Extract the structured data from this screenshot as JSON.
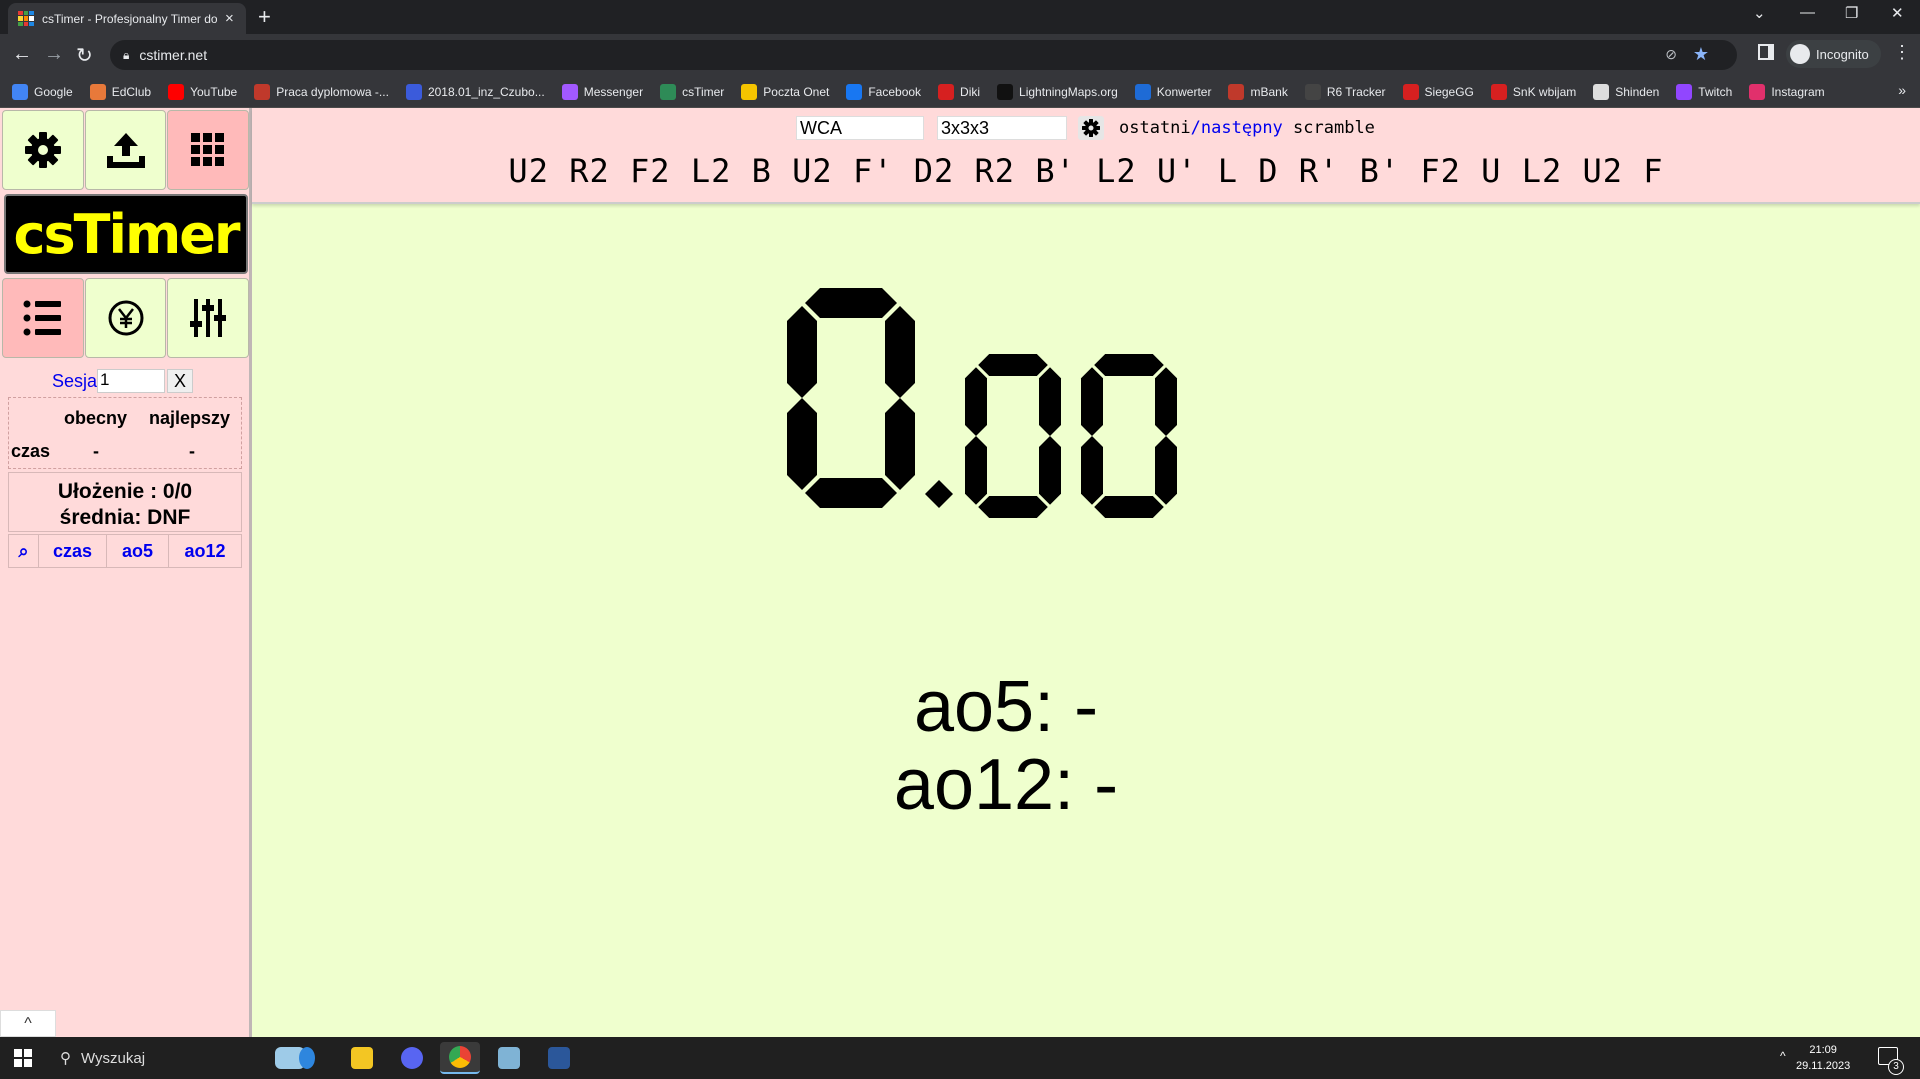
{
  "browser": {
    "tab_title": "csTimer - Profesjonalny Timer do kostki Rubika",
    "tab_close": "×",
    "new_tab": "+",
    "url": "cstimer.net",
    "profile_label": "Incognito",
    "bookmarks": [
      {
        "label": "Google",
        "color": "#4285f4"
      },
      {
        "label": "EdClub",
        "color": "#e8793a"
      },
      {
        "label": "YouTube",
        "color": "#ff0000"
      },
      {
        "label": "Praca dyplomowa -...",
        "color": "#c0392b"
      },
      {
        "label": "2018.01_inz_Czubo...",
        "color": "#3b5bdb"
      },
      {
        "label": "Messenger",
        "color": "#a259ff"
      },
      {
        "label": "csTimer",
        "color": "#2e8b57"
      },
      {
        "label": "Poczta Onet",
        "color": "#f5c400"
      },
      {
        "label": "Facebook",
        "color": "#1877f2"
      },
      {
        "label": "Diki",
        "color": "#d62020"
      },
      {
        "label": "LightningMaps.org",
        "color": "#111111"
      },
      {
        "label": "Konwerter",
        "color": "#1e6bd6"
      },
      {
        "label": "mBank",
        "color": "#c0392b"
      },
      {
        "label": "R6 Tracker",
        "color": "#444444"
      },
      {
        "label": "SiegeGG",
        "color": "#d62020"
      },
      {
        "label": "SnK wbijam",
        "color": "#d62020"
      },
      {
        "label": "Shinden",
        "color": "#dddddd"
      },
      {
        "label": "Twitch",
        "color": "#9146ff"
      },
      {
        "label": "Instagram",
        "color": "#e1306c"
      }
    ],
    "bookmarks_more": "»"
  },
  "toolbar": {
    "scramble_type": "WCA",
    "puzzle": "3x3x3",
    "nav_last": "ostatni",
    "nav_sep": "/",
    "nav_next": "następny",
    "nav_word": " scramble",
    "scramble": "U2 R2 F2 L2 B U2 F' D2 R2 B' L2 U' L D R' B' F2 U L2 U2 F"
  },
  "sidebar": {
    "logo": "csTimer",
    "session_label": "Sesja",
    "session_value": "1",
    "session_clear": "X",
    "stats": {
      "col_current": "obecny",
      "col_best": "najlepszy",
      "row_label": "czas",
      "current": "-",
      "best": "-"
    },
    "solves_line": "Ułożenie : 0/0",
    "mean_line": "średnia: DNF",
    "table_headers": [
      "⌕",
      "czas",
      "ao5",
      "ao12"
    ],
    "collapse_icon": "^"
  },
  "timer": {
    "value": "0.00",
    "ao5_line": "ao5: -",
    "ao12_line": "ao12: -"
  },
  "taskbar": {
    "search_placeholder": "Wyszukaj",
    "time": "21:09",
    "date": "29.11.2023",
    "notifications": "3"
  }
}
